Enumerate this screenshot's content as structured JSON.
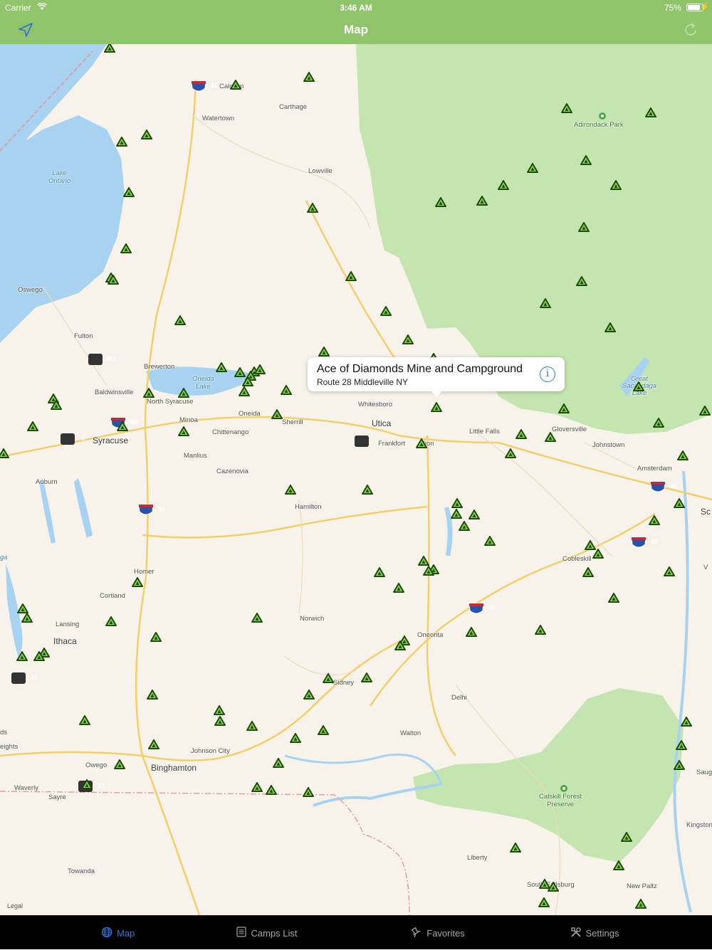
{
  "status": {
    "carrier": "Carrier",
    "time": "3:46 AM",
    "battery": "75%"
  },
  "nav": {
    "title": "Map"
  },
  "callout": {
    "title": "Ace of Diamonds Mine and Campground",
    "subtitle": "Route 28 Middleville NY"
  },
  "map": {
    "legal": "Legal",
    "places": {
      "calcium": "Calcium",
      "carthage": "Carthage",
      "watertown": "Watertown",
      "lowville": "Lowville",
      "adirondack": "Adirondack Park",
      "lake_ontario": "Lake\nOntario",
      "oswego": "Oswego",
      "fulton": "Fulton",
      "brewerton": "Brewerton",
      "oneida_lake": "Oneida\nLake",
      "baldwinsville": "Baldwinsville",
      "north_syracuse": "North Syracuse",
      "minoa": "Minoa",
      "oneida": "Oneida",
      "sherrill": "Sherrill",
      "whitesboro": "Whitesboro",
      "utica": "Utica",
      "frankfort": "Frankfort",
      "ilion": "Ilion",
      "little_falls": "Little Falls",
      "gloversville": "Gloversville",
      "johnstown": "Johnstown",
      "great_sacandaga": "Great\nSacandaga\nLake",
      "amsterdam": "Amsterdam",
      "syracuse": "Syracuse",
      "chittenango": "Chittenango",
      "manlius": "Manlius",
      "cazenovia": "Cazenovia",
      "auburn": "Auburn",
      "hamilton": "Hamilton",
      "cobleskill": "Cobleskill",
      "homer": "Homer",
      "cortland": "Cortland",
      "norwich": "Norwich",
      "lansing": "Lansing",
      "ithaca": "Ithaca",
      "oneonta": "Oneonta",
      "sidney": "Sidney",
      "delhi": "Delhi",
      "walton": "Walton",
      "johnson_city": "Johnson City",
      "owego": "Owego",
      "binghamton": "Binghamton",
      "waverly": "Waverly",
      "sayre": "Sayre",
      "catskill": "Catskill Forest\nPreserve",
      "towanda": "Towanda",
      "liberty": "Liberty",
      "south_fallsburg": "South Fallsburg",
      "new_paltz": "New Paltz",
      "kingston": "Kingston",
      "ga": "ga",
      "ds": "ds",
      "eights": "eights",
      "sc": "Sc",
      "v": "V",
      "saug": "Saug"
    },
    "shields": {
      "i81a": "81",
      "r481": "481",
      "i690": "690",
      "r5": "5",
      "r8": "8",
      "i81b": "81",
      "i90": "90",
      "i88a": "88",
      "i88b": "88",
      "r13": "13",
      "r17": "17"
    }
  },
  "tabs": [
    {
      "label": "Map",
      "icon": "globe-icon",
      "active": true
    },
    {
      "label": "Camps List",
      "icon": "list-icon",
      "active": false
    },
    {
      "label": "Favorites",
      "icon": "pin-icon",
      "active": false
    },
    {
      "label": "Settings",
      "icon": "tools-icon",
      "active": false
    }
  ],
  "colors": {
    "bar": "#90c46a",
    "park": "#c5e5b0",
    "water": "#a8d3f0",
    "campFill": "#8fd14f",
    "campStroke": "#1a4d0a",
    "active": "#2a7ae2"
  }
}
